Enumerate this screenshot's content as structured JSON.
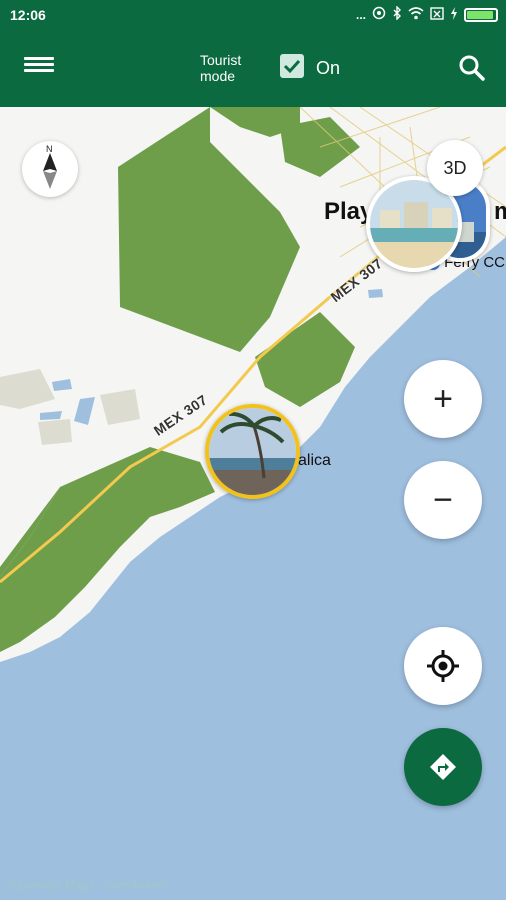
{
  "status_bar": {
    "time": "12:06",
    "dots": "...",
    "icons": [
      "alarm-icon",
      "bluetooth-icon",
      "wifi-icon",
      "sim-icon",
      "charging-icon",
      "battery-icon"
    ]
  },
  "app_bar": {
    "tourist_mode_label_1": "Tourist",
    "tourist_mode_label_2": "mode",
    "toggle_state": "On",
    "checkbox_checked": true,
    "accent_color": "#0b6a3f"
  },
  "map": {
    "city_label": "Play",
    "city_label_suffix": "m",
    "ferry_label": "Ferry CC",
    "road_label_1": "MEX 307",
    "road_label_2": "MEX 307",
    "place_label": "alica",
    "compass_letter": "N",
    "water_color": "#9fbfdf",
    "land_color": "#f5f5f3",
    "park_color": "#6e9e4a"
  },
  "controls": {
    "button_3d": "3D",
    "zoom_in": "+",
    "zoom_out": "−"
  },
  "watermark": "Tripomatic Maps · contributors"
}
